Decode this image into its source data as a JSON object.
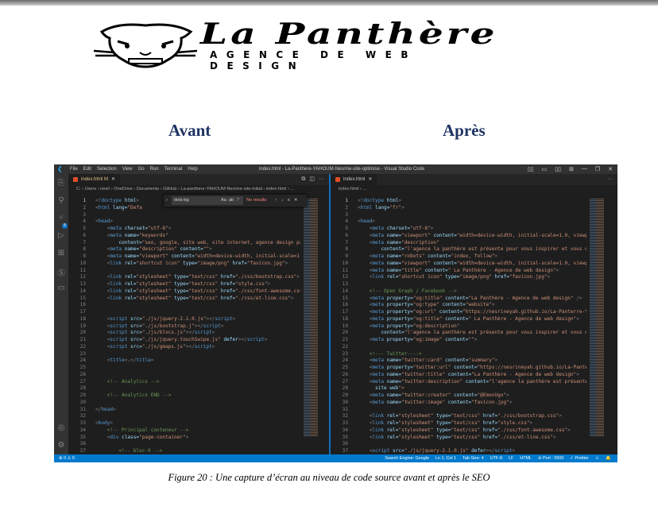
{
  "logo": {
    "title": "La Panthère",
    "subtitle": "AGENCE DE WEB DESIGN"
  },
  "headings": {
    "before": "Avant",
    "after": "Après"
  },
  "vscode": {
    "menu": [
      "File",
      "Edit",
      "Selection",
      "View",
      "Go",
      "Run",
      "Terminal",
      "Help"
    ],
    "window_title": "index.html - La-Panthere-YAHOUM-Nesrine-site-optimise - Visual Studio Code",
    "window_controls": [
      "▯▯",
      "▭",
      "▯▯",
      "⊞",
      "—",
      "❐",
      "✕"
    ],
    "activity_icons": [
      "explorer-icon",
      "search-icon",
      "source-control-icon",
      "run-debug-icon",
      "extensions-icon",
      "s-icon",
      "folder-icon",
      "account-icon",
      "settings-icon"
    ],
    "scm_badge": "8",
    "left": {
      "tab": "index.html M",
      "breadcrumb": "C: › Users › nesri › OneDrive › Documents › GitHub › La-panthere-YAHOUM-Nesrine-site-initial › index.html › ...",
      "find": {
        "query": "dots-bg",
        "options": [
          "Aa",
          "ab",
          ".*"
        ],
        "result": "No results",
        "nav": [
          "↑",
          "↓",
          "≡",
          "✕"
        ]
      },
      "lines": [
        "<!doctype html>",
        "<html lang=\"Defa",
        "",
        "<head>",
        "    <meta charset=\"utf-8\">",
        "    <meta name=\"keywords\"",
        "        content=\"seo, google, site web, site internet, agence design par",
        "    <meta name=\"description\" content=\"\">",
        "    <meta name=\"viewport\" content=\"width=device-width, initial-scale=1.0,",
        "    <link rel=\"shortcut icon\" type=\"image/png\" href=\"favicon.jpg\">",
        "",
        "    <link rel=\"stylesheet\" type=\"text/css\" href=\"./css/bootstrap.css\">",
        "    <link rel=\"stylesheet\" type=\"text/css\" href=\"style.css\">",
        "    <link rel=\"stylesheet\" type=\"text/css\" href=\"./css/font-awesome.css\"",
        "    <link rel=\"stylesheet\" type=\"text/css\" href=\"./css/et-line.css\">",
        "",
        "",
        "    <script src=\"./js/jquery-2.1.0.js\"></script>",
        "    <script src=\"./js/bootstrap.j\"></script>",
        "    <script src=\"./js/blocs.js\"></script>",
        "    <script src=\"./js/jquery.touchSwipe.js\" defer></script>",
        "    <script src=\"./js/gmaps.js\"></script>",
        "",
        "    <title>.</title>",
        "",
        "",
        "    <!-- Analytics -->",
        "",
        "    <!-- Analytics END -->",
        "",
        "</head>",
        "",
        "<body>",
        "    <!-- Principal conteneur -->",
        "    <div class=\"page-container\">",
        "",
        "        <!-- bloc-0 -->"
      ]
    },
    "right": {
      "tab": "index.html",
      "breadcrumb": "index.html › ...",
      "lines": [
        "<!doctype html>",
        "<html lang=\"fr\">",
        "",
        "<head>",
        "    <meta charset=\"utf-8\">",
        "    <meta name=\"viewport\" content=\"width=device-width, initial-scale=1.0, viewport",
        "    <meta name=\"description\"",
        "        content=\"l'agence la panthère est présente pour vous inspirer et vous donn",
        "    <meta name=\"robots\" content=\"index, follow\">",
        "    <meta name=\"viewport\" content=\"width=device-width, initial-scale=1.0, viewport",
        "    <meta name=\"title\" content=\" La Panthère - Agence de web design\">",
        "    <link rel=\"shortcut icon\" type=\"image/png\" href=\"favicon.jpg\">",
        "",
        "    <!-- Open Graph / Facebook -->",
        "    <meta property=\"og:title\" content=\"La Panthère - Agence de web design\" />",
        "    <meta property=\"og:type\" content=\"website\">",
        "    <meta property=\"og:url\" content=\"https://nesrineyah.github.io/La-Panterre-YAH",
        "    <meta property=\"og:title\" content=\" La Panthère - Agence de web design\">",
        "    <meta property=\"og:description\"",
        "        content=\"l'agence la panthère est présente pour vous inspirer et vous donn",
        "    <meta property=\"og:image\" content=\"\">",
        "",
        "    <!--- Twitter---->",
        "    <meta name=\"twitter:card\" content=\"summary\">",
        "    <meta property=\"twitter:url\" content=\"https://nesrineyah.github.io/La-Panterre",
        "    <meta name=\"twitter:title\" content=\"La Panthère - Agence de web design\">",
        "    <meta name=\"twitter:description\" content=\"l'agence la panthère est présente p",
        "      site web\">",
        "    <meta name=\"twitter:creator\" content=\"@EmonUgo\">",
        "    <meta name=\"twitter:image\" content=\"favicon.jpg\">",
        "",
        "    <link rel=\"stylesheet\" type=\"text/css\" href=\"./css/bootstrap.css\">",
        "    <link rel=\"stylesheet\" type=\"text/css\" href=\"style.css\">",
        "    <link rel=\"stylesheet\" type=\"text/css\" href=\"./css/font-awesome.css\">",
        "    <link rel=\"stylesheet\" type=\"text/css\" href=\"./css/et-line.css\">",
        "",
        "    <script src=\"./js/jquery-2.1.0.js\" defer></script>"
      ]
    },
    "status": {
      "left": "⊗ 0 ⚠ 0",
      "right": [
        "Search Engine: Google",
        "Ln 1, Col 1",
        "Tab Size: 4",
        "UTF-8",
        "LF",
        "HTML",
        "⊘ Port : 5500",
        "✓ Prettier",
        "☺",
        "🔔"
      ]
    },
    "colors": {
      "statusbar": "#007acc",
      "editor_bg": "#1e1e1e",
      "tag": "#569cd6",
      "attr": "#9cdcfe",
      "string": "#ce9178",
      "comment": "#6a9955"
    }
  },
  "caption": "Figure 20 :  Une capture d’écran au niveau de code source avant et après le SEO"
}
